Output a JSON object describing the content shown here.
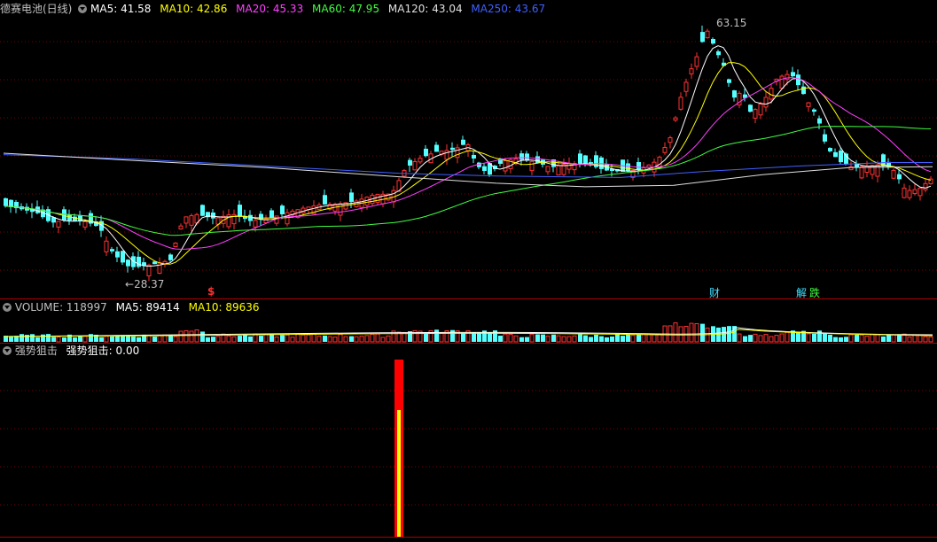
{
  "main": {
    "title": "德赛电池(日线)",
    "ma": [
      {
        "label": "MA5: 41.58",
        "color": "#ffffff"
      },
      {
        "label": "MA10: 42.86",
        "color": "#ffff00"
      },
      {
        "label": "MA20: 45.33",
        "color": "#ff40ff"
      },
      {
        "label": "MA60: 47.95",
        "color": "#40ff40"
      },
      {
        "label": "MA120: 43.04",
        "color": "#e0e0e0"
      },
      {
        "label": "MA250: 43.67",
        "color": "#4060ff"
      }
    ],
    "high_label": "63.15",
    "low_label": "28.37",
    "markers": [
      {
        "text": "$",
        "color": "#ff3030",
        "xfrac": 0.225
      },
      {
        "text": "财",
        "color": "#40e0ff",
        "xfrac": 0.762
      },
      {
        "text": "解",
        "color": "#40e0ff",
        "xfrac": 0.852
      },
      {
        "text": "跌",
        "color": "#40ff40",
        "xfrac": 0.867
      }
    ]
  },
  "volume": {
    "title": "VOLUME: 118997",
    "ma5": "MA5: 89414",
    "ma10": "MA10: 89636"
  },
  "indicator": {
    "title": "强势狙击",
    "value_label": "强势狙击: 0.00"
  },
  "colors": {
    "up": "#ff3232",
    "down": "#54ffff",
    "grid": "#7a0000",
    "border": "#b00000"
  }
}
